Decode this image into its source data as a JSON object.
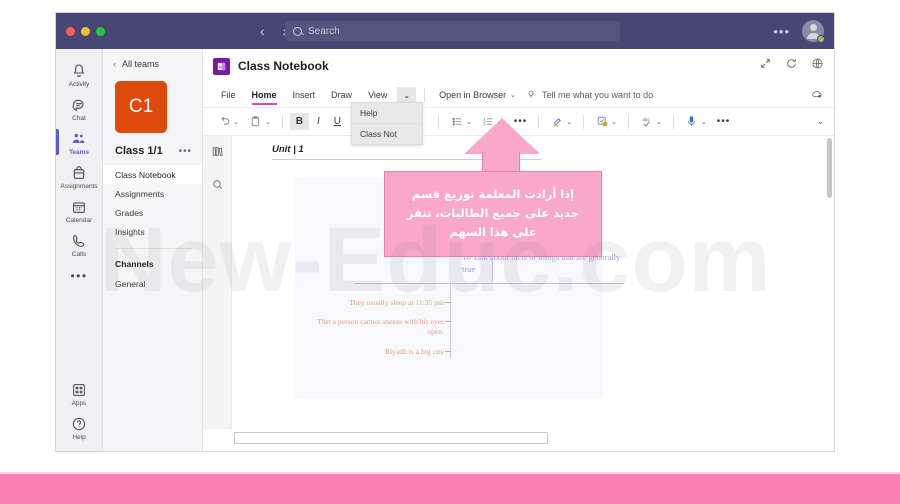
{
  "window": {
    "titlebar": {
      "back_label": "‹",
      "forward_label": "›",
      "search_placeholder": "Search",
      "more_label": "•••",
      "avatar_name": "account-avatar"
    }
  },
  "app_rail": {
    "items": [
      {
        "label": "Activity",
        "icon": "bell-icon"
      },
      {
        "label": "Chat",
        "icon": "chat-icon"
      },
      {
        "label": "Teams",
        "icon": "teams-icon"
      },
      {
        "label": "Assignments",
        "icon": "assignments-icon"
      },
      {
        "label": "Calendar",
        "icon": "calendar-icon"
      },
      {
        "label": "Calls",
        "icon": "calls-icon"
      }
    ],
    "more_label": "•••",
    "bottom_items": [
      {
        "label": "Apps",
        "icon": "apps-icon"
      },
      {
        "label": "Help",
        "icon": "help-icon"
      }
    ]
  },
  "team_panel": {
    "all_teams_label": "All teams",
    "back_chevron": "‹",
    "team_initials": "C1",
    "team_name": "Class 1/1",
    "team_more": "•••",
    "nav_items": [
      {
        "label": "Class Notebook",
        "selected": true
      },
      {
        "label": "Assignments",
        "selected": false
      },
      {
        "label": "Grades",
        "selected": false
      },
      {
        "label": "Insights",
        "selected": false
      }
    ],
    "channels_header": "Channels",
    "channels": [
      {
        "label": "General"
      }
    ]
  },
  "onenote": {
    "app_title": "Class Notebook",
    "header_icons": [
      "expand-icon",
      "refresh-icon",
      "globe-icon"
    ],
    "ribbon_tabs": [
      {
        "label": "File",
        "active": false
      },
      {
        "label": "Home",
        "active": true
      },
      {
        "label": "Insert",
        "active": false
      },
      {
        "label": "Draw",
        "active": false
      },
      {
        "label": "View",
        "active": false
      }
    ],
    "ribbon_chevron": "⌄",
    "open_in_browser_label": "Open in Browser",
    "open_in_browser_chevron": "⌄",
    "tell_me_label": "Tell me what you want to do",
    "toolbar": {
      "undo_label": "↺",
      "paste_label": "paste-icon",
      "bold_label": "B",
      "italic_label": "I",
      "underline_label": "U",
      "bullet_list_label": "bullet-list-icon",
      "numbered_list_label": "numbered-list-icon",
      "more_format_label": "•••",
      "highlighter_label": "highlighter-icon",
      "tag_label": "tag-icon",
      "spellcheck_label": "spellcheck-icon",
      "dictate_label": "dictate-icon",
      "more_label": "•••",
      "collapse_label": "⌄",
      "chevron": "⌄"
    },
    "dropdown": {
      "items": [
        {
          "label": "Help"
        },
        {
          "label": "Class Not"
        }
      ]
    },
    "note_rail_icons": [
      "notebooks-icon",
      "search-icon"
    ],
    "page": {
      "unit_title": "Unit | 1",
      "topic": "To Talk about facts or things that are generally true",
      "examples": [
        "They usually sleep at 11:35 pm",
        "That a person cannot sneeze with his eyes open.",
        "Riyadh is a big city"
      ]
    }
  },
  "callout": {
    "text": "إذا أرادت المعلمة توزيع قسم جديد على جميع الطالبات، تنقر على هذا السهم",
    "color": "#f9a8c9"
  },
  "watermark": {
    "text": "New-Educ.com"
  },
  "banner": {
    "color": "#fb7fb5"
  }
}
